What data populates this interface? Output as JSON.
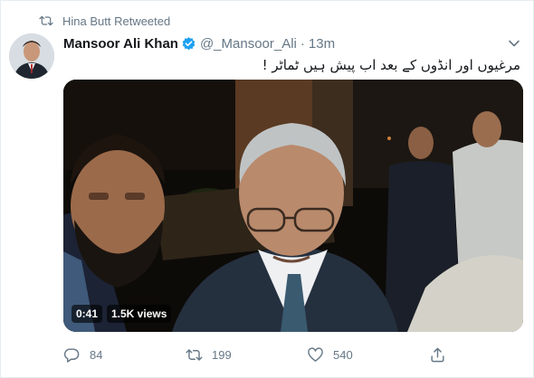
{
  "retweet_context": {
    "label": "Hina Butt Retweeted",
    "icon": "retweet-icon"
  },
  "tweet": {
    "author_name": "Mansoor Ali Khan",
    "handle": "@_Mansoor_Ali",
    "separator": "·",
    "time": "13m",
    "text": "مرغیوں اور انڈوں کے بعد اب پیش ہیں ٹماٹر !",
    "verified_icon": "verified-badge-icon",
    "menu_icon": "chevron-down-icon",
    "accent_color": "#1da1f2"
  },
  "media": {
    "duration": "0:41",
    "views": "1.5K views"
  },
  "actions": {
    "reply_count": "84",
    "retweet_count": "199",
    "like_count": "540",
    "reply_icon": "reply-icon",
    "retweet_icon": "retweet-icon",
    "like_icon": "heart-icon",
    "share_icon": "share-icon"
  }
}
